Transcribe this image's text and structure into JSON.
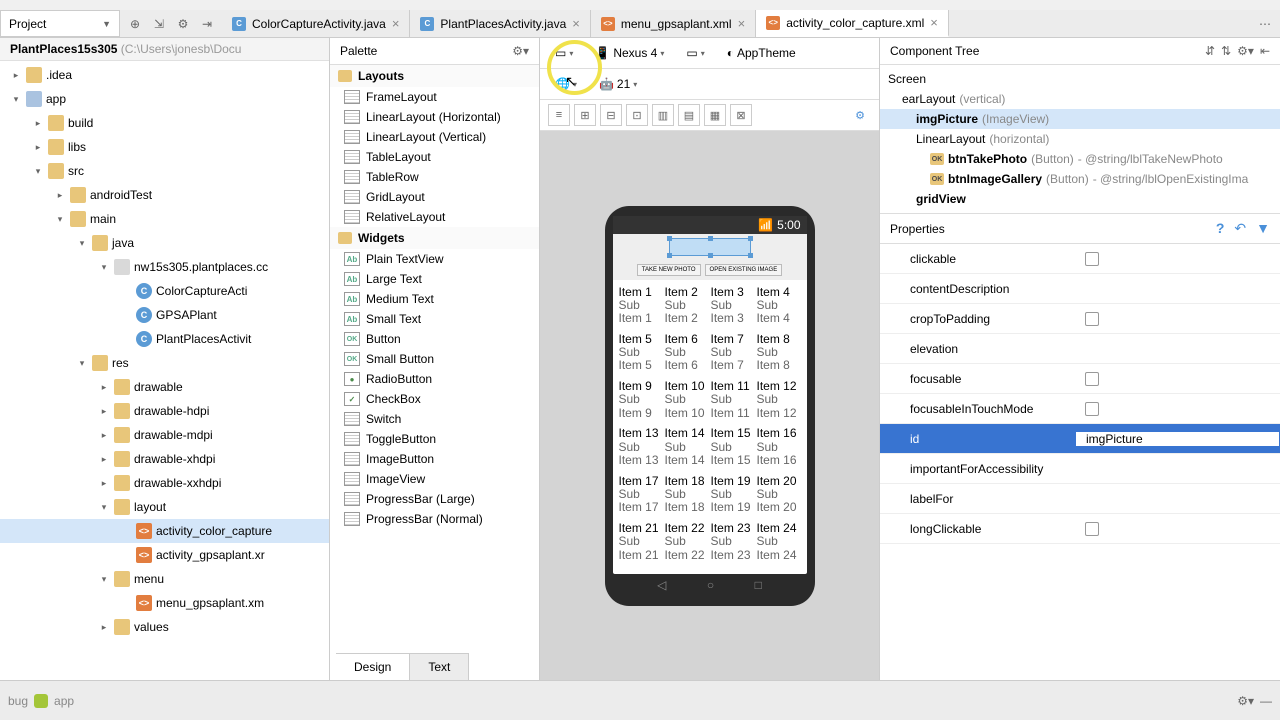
{
  "project_dropdown": "Project",
  "editor_tabs": [
    {
      "label": "ColorCaptureActivity.java",
      "type": "java",
      "active": false
    },
    {
      "label": "PlantPlacesActivity.java",
      "type": "java",
      "active": false
    },
    {
      "label": "menu_gpsaplant.xml",
      "type": "xml",
      "active": false
    },
    {
      "label": "activity_color_capture.xml",
      "type": "xml",
      "active": true
    }
  ],
  "project_header": {
    "module": "PlantPlaces15s305",
    "path": "(C:\\Users\\jonesb\\Docu"
  },
  "tree": [
    {
      "depth": 0,
      "exp": "▸",
      "icon": "ic-folder",
      "label": ".idea"
    },
    {
      "depth": 0,
      "exp": "▾",
      "icon": "ic-module",
      "label": "app"
    },
    {
      "depth": 1,
      "exp": "▸",
      "icon": "ic-folder",
      "label": "build"
    },
    {
      "depth": 1,
      "exp": "▸",
      "icon": "ic-folder",
      "label": "libs"
    },
    {
      "depth": 1,
      "exp": "▾",
      "icon": "ic-folder",
      "label": "src"
    },
    {
      "depth": 2,
      "exp": "▸",
      "icon": "ic-folder",
      "label": "androidTest"
    },
    {
      "depth": 2,
      "exp": "▾",
      "icon": "ic-folder",
      "label": "main"
    },
    {
      "depth": 3,
      "exp": "▾",
      "icon": "ic-folder",
      "label": "java"
    },
    {
      "depth": 4,
      "exp": "▾",
      "icon": "ic-pkg",
      "label": "nw15s305.plantplaces.cc"
    },
    {
      "depth": 5,
      "exp": "",
      "icon": "ic-cls",
      "label": "ColorCaptureActi"
    },
    {
      "depth": 5,
      "exp": "",
      "icon": "ic-cls",
      "label": "GPSAPlant"
    },
    {
      "depth": 5,
      "exp": "",
      "icon": "ic-cls",
      "label": "PlantPlacesActivit"
    },
    {
      "depth": 3,
      "exp": "▾",
      "icon": "ic-folder",
      "label": "res"
    },
    {
      "depth": 4,
      "exp": "▸",
      "icon": "ic-folder",
      "label": "drawable"
    },
    {
      "depth": 4,
      "exp": "▸",
      "icon": "ic-folder",
      "label": "drawable-hdpi"
    },
    {
      "depth": 4,
      "exp": "▸",
      "icon": "ic-folder",
      "label": "drawable-mdpi"
    },
    {
      "depth": 4,
      "exp": "▸",
      "icon": "ic-folder",
      "label": "drawable-xhdpi"
    },
    {
      "depth": 4,
      "exp": "▸",
      "icon": "ic-folder",
      "label": "drawable-xxhdpi"
    },
    {
      "depth": 4,
      "exp": "▾",
      "icon": "ic-folder",
      "label": "layout"
    },
    {
      "depth": 5,
      "exp": "",
      "icon": "ic-lay",
      "label": "activity_color_capture",
      "selected": true
    },
    {
      "depth": 5,
      "exp": "",
      "icon": "ic-lay",
      "label": "activity_gpsaplant.xr"
    },
    {
      "depth": 4,
      "exp": "▾",
      "icon": "ic-folder",
      "label": "menu"
    },
    {
      "depth": 5,
      "exp": "",
      "icon": "ic-lay",
      "label": "menu_gpsaplant.xm"
    },
    {
      "depth": 4,
      "exp": "▸",
      "icon": "ic-folder",
      "label": "values"
    }
  ],
  "palette": {
    "title": "Palette",
    "groups": [
      {
        "name": "Layouts",
        "items": [
          {
            "icon": "lay",
            "label": "FrameLayout"
          },
          {
            "icon": "lay",
            "label": "LinearLayout (Horizontal)"
          },
          {
            "icon": "lay",
            "label": "LinearLayout (Vertical)"
          },
          {
            "icon": "lay",
            "label": "TableLayout"
          },
          {
            "icon": "lay",
            "label": "TableRow"
          },
          {
            "icon": "lay",
            "label": "GridLayout"
          },
          {
            "icon": "lay",
            "label": "RelativeLayout"
          }
        ]
      },
      {
        "name": "Widgets",
        "items": [
          {
            "icon": "ab",
            "label": "Plain TextView"
          },
          {
            "icon": "ab",
            "label": "Large Text"
          },
          {
            "icon": "ab",
            "label": "Medium Text"
          },
          {
            "icon": "ab",
            "label": "Small Text"
          },
          {
            "icon": "ok",
            "label": "Button"
          },
          {
            "icon": "ok",
            "label": "Small Button"
          },
          {
            "icon": "rad",
            "label": "RadioButton"
          },
          {
            "icon": "chk",
            "label": "CheckBox"
          },
          {
            "icon": "lay",
            "label": "Switch"
          },
          {
            "icon": "lay",
            "label": "ToggleButton"
          },
          {
            "icon": "lay",
            "label": "ImageButton"
          },
          {
            "icon": "lay",
            "label": "ImageView"
          },
          {
            "icon": "lay",
            "label": "ProgressBar (Large)"
          },
          {
            "icon": "lay",
            "label": "ProgressBar (Normal)"
          }
        ]
      }
    ]
  },
  "design_toolbar": {
    "device": "Nexus 4",
    "theme": "AppTheme",
    "api": "21"
  },
  "phone": {
    "time": "5:00",
    "btn1": "TAKE NEW PHOTO",
    "btn2": "OPEN EXISTING IMAGE",
    "grid_items": [
      {
        "t": "Item 1",
        "s": "Sub Item 1"
      },
      {
        "t": "Item 2",
        "s": "Sub Item 2"
      },
      {
        "t": "Item 3",
        "s": "Sub Item 3"
      },
      {
        "t": "Item 4",
        "s": "Sub Item 4"
      },
      {
        "t": "Item 5",
        "s": "Sub Item 5"
      },
      {
        "t": "Item 6",
        "s": "Sub Item 6"
      },
      {
        "t": "Item 7",
        "s": "Sub Item 7"
      },
      {
        "t": "Item 8",
        "s": "Sub Item 8"
      },
      {
        "t": "Item 9",
        "s": "Sub Item 9"
      },
      {
        "t": "Item 10",
        "s": "Sub Item 10"
      },
      {
        "t": "Item 11",
        "s": "Sub Item 11"
      },
      {
        "t": "Item 12",
        "s": "Sub Item 12"
      },
      {
        "t": "Item 13",
        "s": "Sub Item 13"
      },
      {
        "t": "Item 14",
        "s": "Sub Item 14"
      },
      {
        "t": "Item 15",
        "s": "Sub Item 15"
      },
      {
        "t": "Item 16",
        "s": "Sub Item 16"
      },
      {
        "t": "Item 17",
        "s": "Sub Item 17"
      },
      {
        "t": "Item 18",
        "s": "Sub Item 18"
      },
      {
        "t": "Item 19",
        "s": "Sub Item 19"
      },
      {
        "t": "Item 20",
        "s": "Sub Item 20"
      },
      {
        "t": "Item 21",
        "s": "Sub Item 21"
      },
      {
        "t": "Item 22",
        "s": "Sub Item 22"
      },
      {
        "t": "Item 23",
        "s": "Sub Item 23"
      },
      {
        "t": "Item 24",
        "s": "Sub Item 24"
      }
    ]
  },
  "design_tabs": {
    "design": "Design",
    "text": "Text"
  },
  "component_tree": {
    "title": "Component Tree",
    "rows": [
      {
        "depth": 0,
        "label": "Screen",
        "name": ""
      },
      {
        "depth": 1,
        "label": "earLayout",
        "type": "(vertical)"
      },
      {
        "depth": 2,
        "label": "imgPicture",
        "type": "(ImageView)",
        "selected": true,
        "bold": true
      },
      {
        "depth": 2,
        "label": "LinearLayout",
        "type": "(horizontal)"
      },
      {
        "depth": 3,
        "label": "btnTakePhoto",
        "type": "(Button)",
        "ref": "- @string/lblTakeNewPhoto",
        "bold": true,
        "ok": true
      },
      {
        "depth": 3,
        "label": "btnImageGallery",
        "type": "(Button)",
        "ref": "- @string/lblOpenExistingIma",
        "bold": true,
        "ok": true
      },
      {
        "depth": 2,
        "label": "gridView",
        "bold": true
      }
    ]
  },
  "properties": {
    "title": "Properties",
    "rows": [
      {
        "name": "clickable",
        "checkbox": true
      },
      {
        "name": "contentDescription"
      },
      {
        "name": "cropToPadding",
        "checkbox": true
      },
      {
        "name": "elevation"
      },
      {
        "name": "focusable",
        "checkbox": true
      },
      {
        "name": "focusableInTouchMode",
        "checkbox": true
      },
      {
        "name": "id",
        "value": "imgPicture",
        "selected": true
      },
      {
        "name": "importantForAccessibility"
      },
      {
        "name": "labelFor"
      },
      {
        "name": "longClickable",
        "checkbox": true
      }
    ]
  },
  "bottom": {
    "debug": "bug",
    "app": "app"
  }
}
